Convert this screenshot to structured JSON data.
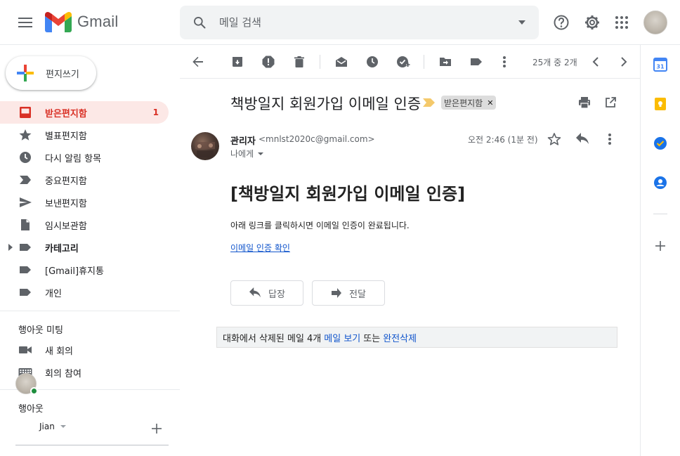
{
  "header": {
    "app_name": "Gmail",
    "search_placeholder": "메일 검색"
  },
  "sidebar": {
    "compose_label": "편지쓰기",
    "items": [
      {
        "label": "받은편지함",
        "count": "1"
      },
      {
        "label": "별표편지함"
      },
      {
        "label": "다시 알림 항목"
      },
      {
        "label": "중요편지함"
      },
      {
        "label": "보낸편지함"
      },
      {
        "label": "임시보관함"
      },
      {
        "label": "카테고리"
      },
      {
        "label": "[Gmail]휴지통"
      },
      {
        "label": "개인"
      }
    ],
    "meet": {
      "title": "행아웃 미팅",
      "new_meeting": "새 회의",
      "join_meeting": "회의 참여"
    },
    "hangouts": {
      "title": "행아웃",
      "user": "Jian"
    }
  },
  "toolbar": {
    "pager": "25개 중 2개"
  },
  "message": {
    "subject": "책방일지 회원가입 이메일 인증",
    "label_chip": "받은편지함",
    "sender_name": "관리자",
    "sender_email": "<mnlst2020c@gmail.com>",
    "to": "나에게",
    "date": "오전 2:46 (1분 전)",
    "body_heading": "[책방일지 회원가입 이메일 인증]",
    "body_text": "아래 링크를 클릭하시면 이메일 인증이 완료됩니다.",
    "body_link": "이메일 인증 확인",
    "reply_label": "답장",
    "forward_label": "전달"
  },
  "deleted_notice": {
    "text": "대화에서 삭제된 메일 4개",
    "view_link": "메일 보기",
    "or_text": "또는",
    "delete_link": "완전삭제"
  },
  "colors": {
    "active_bg": "#fce8e6",
    "active_text": "#d93025",
    "link": "#1155cc"
  }
}
